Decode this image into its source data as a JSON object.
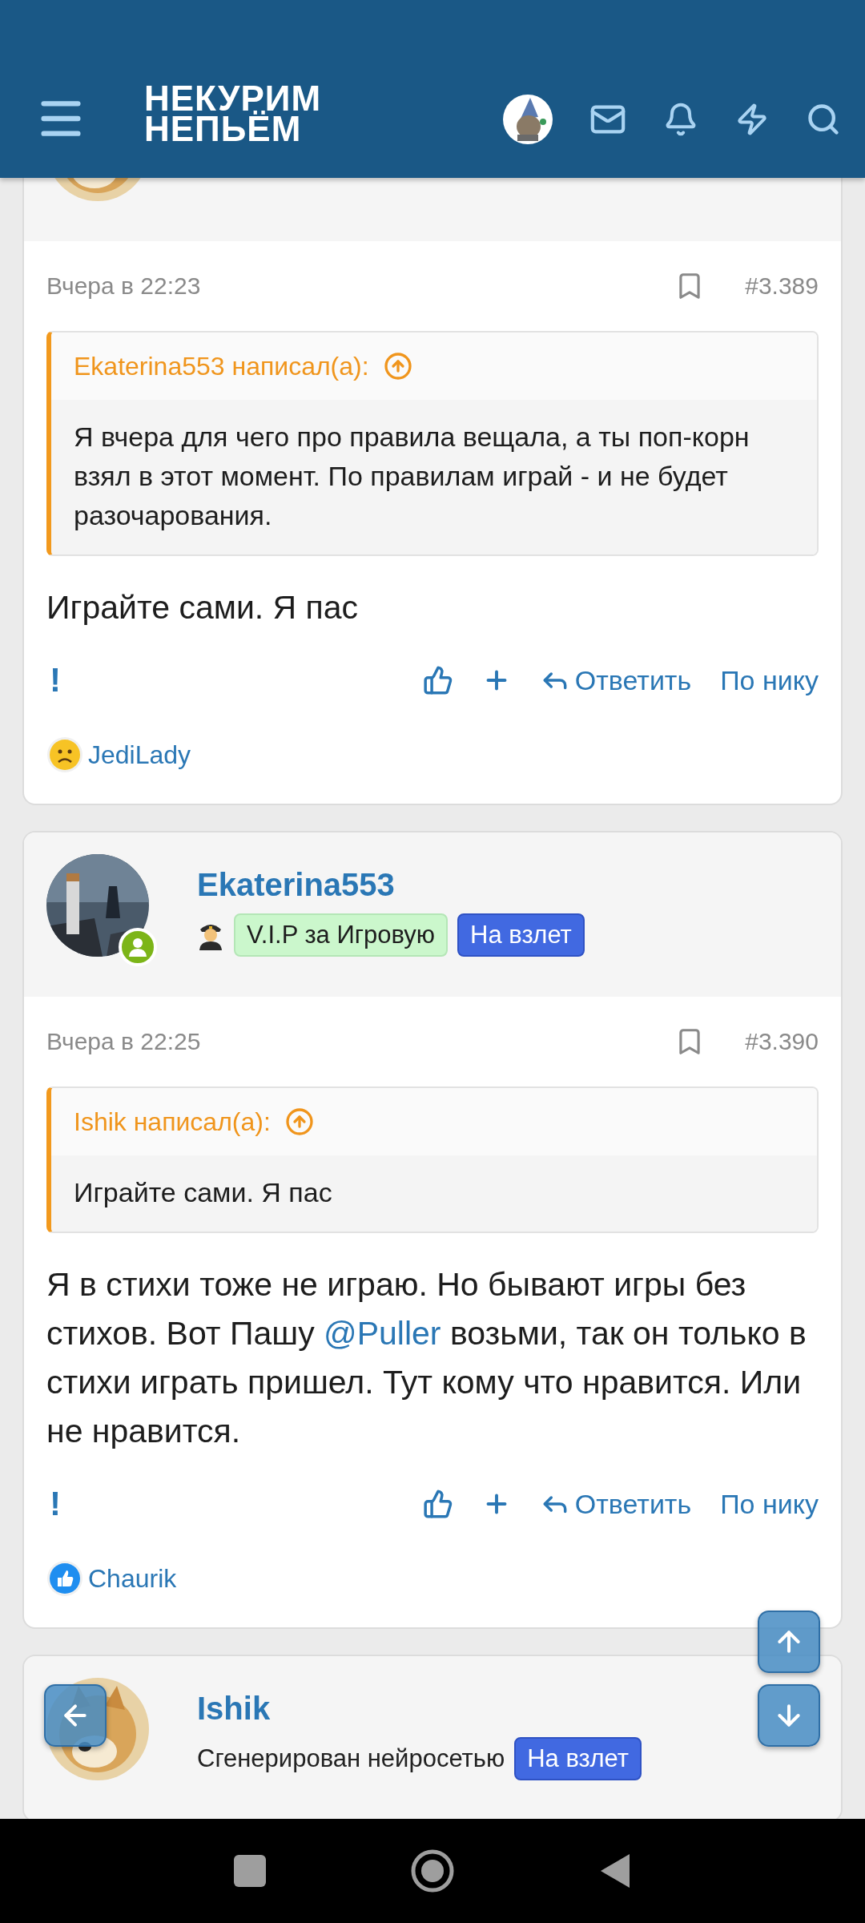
{
  "header": {
    "logo_lines": [
      "НЕКУРИМ",
      "НЕПЬЁМ"
    ]
  },
  "posts": [
    {
      "online": false,
      "date": "Вчера в 22:23",
      "number": "#3.389",
      "quote": {
        "author": "Ekaterina553 написал(а):",
        "text": "Я вчера для чего про правила вещала, а ты поп-корн взял в этот момент. По правилам играй - и не будет разочарования."
      },
      "body": [
        {
          "kind": "text",
          "text": "Играйте сами. Я пас"
        }
      ],
      "actions": {
        "report": "!",
        "reply": "Ответить",
        "by_nick": "По нику"
      },
      "reaction": {
        "kind": "sad",
        "user": "JediLady"
      }
    },
    {
      "online": true,
      "name": "Ekaterina553",
      "titles": [
        {
          "kind": "pilot"
        },
        {
          "kind": "green",
          "text": "V.I.P за Игровую"
        },
        {
          "kind": "blue",
          "text": "На взлет"
        }
      ],
      "date": "Вчера в 22:25",
      "number": "#3.390",
      "quote": {
        "author": "Ishik написал(а):",
        "text": "Играйте сами. Я пас"
      },
      "body": [
        {
          "kind": "text",
          "text": "Я в стихи тоже не играю. Но бывают игры без стихов. Вот Пашу "
        },
        {
          "kind": "mention",
          "text": "@Puller"
        },
        {
          "kind": "text",
          "text": " возьми, так он только в стихи играть пришел. Тут кому что нравится. Или не нравится."
        }
      ],
      "actions": {
        "report": "!",
        "reply": "Ответить",
        "by_nick": "По нику"
      },
      "reaction": {
        "kind": "like",
        "user": "Chaurik"
      }
    },
    {
      "online": false,
      "name": "Ishik",
      "titles": [
        {
          "kind": "plain",
          "text": "Сгенерирован нейросетью"
        },
        {
          "kind": "blue",
          "text": "На взлет"
        }
      ]
    }
  ]
}
